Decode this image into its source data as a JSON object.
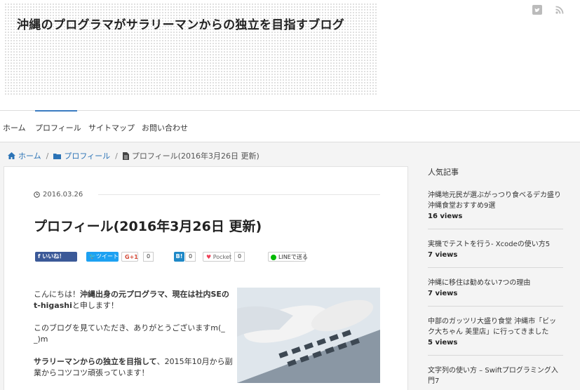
{
  "header": {
    "site_title": "沖縄のプログラマがサラリーマンからの独立を目指すブログ",
    "icons": [
      "twitter-icon",
      "rss-icon"
    ]
  },
  "nav": {
    "items": [
      {
        "label": "ホーム"
      },
      {
        "label": "プロフィール",
        "active": true
      },
      {
        "label": "サイトマップ"
      },
      {
        "label": "お問い合わせ"
      }
    ],
    "accent_color": "#3a7cc1"
  },
  "breadcrumb": {
    "home": "ホーム",
    "category": "プロフィール",
    "current": "プロフィール(2016年3月26日 更新)"
  },
  "post": {
    "date": "2016.03.26",
    "title": "プロフィール(2016年3月26日 更新)",
    "share": {
      "facebook": "いいね！",
      "twitter": "ツイート",
      "google": "G+1",
      "google_count": "0",
      "hatena": "B!",
      "hatena_count": "0",
      "pocket": "Pocket",
      "pocket_count": "0",
      "line": "LINEで送る"
    },
    "body": {
      "p1_a": "こんにちは！",
      "p1_b": "沖縄出身の元プログラマ、現在は社内SEのt-higashi",
      "p1_c": "と申します！",
      "p2": "このブログを見ていただき、ありがとうございますm(_ _)m",
      "p3_a": "サラリーマンからの独立を目指して",
      "p3_b": "、2015年10月から副業からコツコツ頑張っています！"
    }
  },
  "sidebar": {
    "heading": "人気記事",
    "items": [
      {
        "title": "沖縄地元民が選ぶがっつり食べるデカ盛り沖縄食堂おすすめ9選",
        "views": "16 views"
      },
      {
        "title": "実機でテストを行う- Xcodeの使い方5",
        "views": "7 views"
      },
      {
        "title": "沖縄に移住は勧めない7つの理由",
        "views": "7 views"
      },
      {
        "title": "中部のガッツリ大盛り食堂 沖縄市「ビック大ちゃん 美里店」に行ってきました",
        "views": "5 views"
      },
      {
        "title": "文字列の使い方 – Swiftプログラミング入門7",
        "views": ""
      }
    ]
  }
}
